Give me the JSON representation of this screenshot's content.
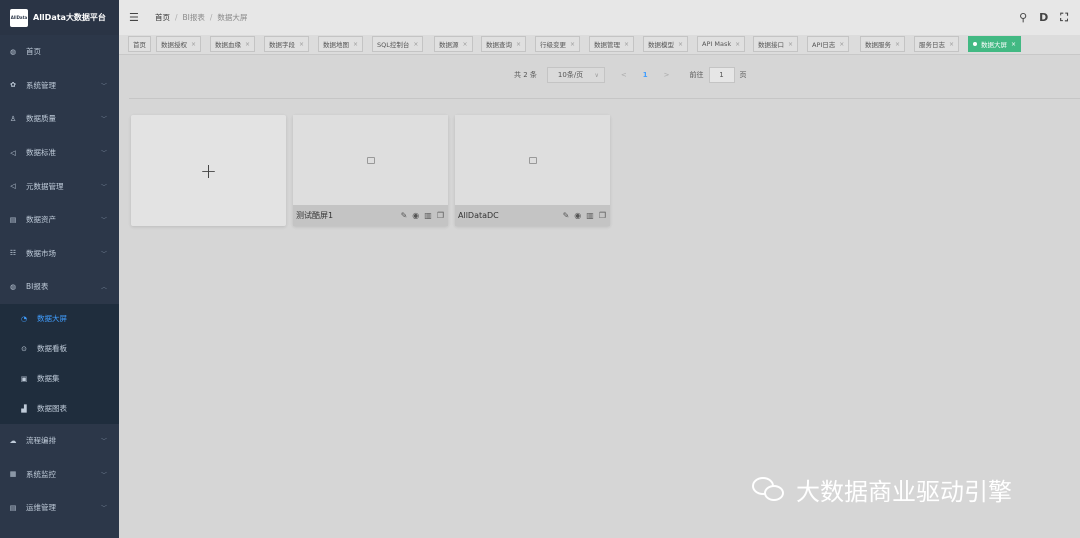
{
  "app": {
    "title": "AllData大数据平台",
    "logo_text": "AllData"
  },
  "sidebar": {
    "items": [
      {
        "label": "首页",
        "icon": "dashboard-icon"
      },
      {
        "label": "系统管理",
        "icon": "gear-icon"
      },
      {
        "label": "数据质量",
        "icon": "user-icon"
      },
      {
        "label": "数据标准",
        "icon": "send-icon"
      },
      {
        "label": "元数据管理",
        "icon": "send-icon"
      },
      {
        "label": "数据资产",
        "icon": "document-icon"
      },
      {
        "label": "数据市场",
        "icon": "table-icon"
      },
      {
        "label": "BI报表",
        "icon": "dashboard-icon"
      }
    ],
    "bi_children": [
      {
        "label": "数据大屏",
        "icon": "screen-icon"
      },
      {
        "label": "数据看板",
        "icon": "clock-icon"
      },
      {
        "label": "数据集",
        "icon": "dataset-icon"
      },
      {
        "label": "数据图表",
        "icon": "bar-chart-icon"
      }
    ],
    "after": [
      {
        "label": "流程编排",
        "icon": "cloud-icon"
      },
      {
        "label": "系统监控",
        "icon": "monitor-icon"
      },
      {
        "label": "运维管理",
        "icon": "server-icon"
      }
    ]
  },
  "breadcrumb": [
    "首页",
    "BI报表",
    "数据大屏"
  ],
  "tags": [
    "首页",
    "数据授权",
    "数据血缘",
    "数据字段",
    "数据地图",
    "SQL控制台",
    "数据源",
    "数据查询",
    "行级变更",
    "数据管理",
    "数据模型",
    "API Mask",
    "数据接口",
    "API日志",
    "数据服务",
    "服务日志",
    "数据大屏"
  ],
  "pagination": {
    "total": "共 2 条",
    "page_size": "10条/页",
    "current": "1",
    "goto": "前往",
    "goto_value": "1",
    "unit": "页"
  },
  "cards": [
    {
      "name": "测试酷屏1"
    },
    {
      "name": "AllDataDC"
    }
  ],
  "watermark": "大数据商业驱动引擎",
  "colors": {
    "sidebar_bg": "#2c3749",
    "accent": "#409eff",
    "tag_active": "#42b983"
  }
}
